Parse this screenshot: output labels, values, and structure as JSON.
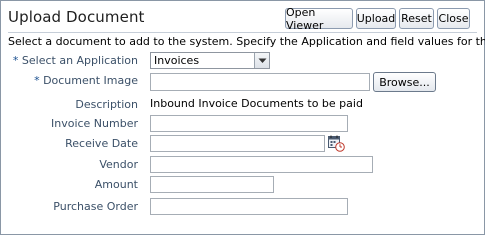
{
  "panel": {
    "title": "Upload Document",
    "buttons": {
      "open_viewer": "Open Viewer",
      "upload": "Upload",
      "reset": "Reset",
      "close": "Close"
    },
    "instructions": "Select a document to add to the system. Specify the Application and field values for that"
  },
  "form": {
    "required_marker": "*",
    "application": {
      "label": "Select an Application",
      "value": "Invoices"
    },
    "document_image": {
      "label": "Document Image",
      "value": "",
      "browse_label": "Browse..."
    },
    "description": {
      "label": "Description",
      "value": "Inbound Invoice Documents to be paid"
    },
    "invoice_number": {
      "label": "Invoice Number",
      "value": ""
    },
    "receive_date": {
      "label": "Receive Date",
      "value": ""
    },
    "vendor": {
      "label": "Vendor",
      "value": ""
    },
    "amount": {
      "label": "Amount",
      "value": ""
    },
    "purchase_order": {
      "label": "Purchase Order",
      "value": ""
    }
  },
  "icons": {
    "calendar": "calendar-icon",
    "dropdown": "chevron-down-icon"
  },
  "colors": {
    "label": "#3b5068",
    "required": "#1a4f8f",
    "border": "#8a97a6"
  }
}
